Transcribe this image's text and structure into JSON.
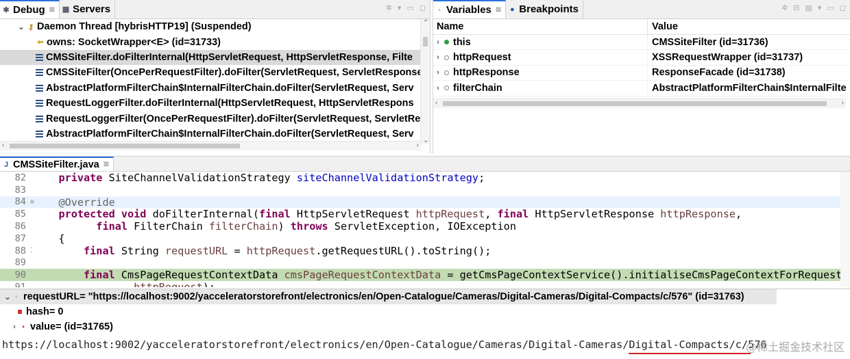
{
  "debug": {
    "tabs": [
      {
        "label": "Debug",
        "close": "⊠"
      },
      {
        "label": "Servers"
      }
    ],
    "thread": "Daemon Thread [hybrisHTTP19] (Suspended)",
    "frames": [
      {
        "label": "owns: SocketWrapper<E>  (id=31733)"
      },
      {
        "label": "CMSSiteFilter.doFilterInternal(HttpServletRequest, HttpServletResponse, Filte"
      },
      {
        "label": "CMSSiteFilter(OncePerRequestFilter).doFilter(ServletRequest, ServletResponse"
      },
      {
        "label": "AbstractPlatformFilterChain$InternalFilterChain.doFilter(ServletRequest, Serv"
      },
      {
        "label": "RequestLoggerFilter.doFilterInternal(HttpServletRequest, HttpServletRespons"
      },
      {
        "label": "RequestLoggerFilter(OncePerRequestFilter).doFilter(ServletRequest, ServletRe"
      },
      {
        "label": "AbstractPlatformFilterChain$InternalFilterChain.doFilter(ServletRequest, Serv"
      }
    ]
  },
  "variables": {
    "tabs": [
      {
        "label": "Variables",
        "close": "⊠"
      },
      {
        "label": "Breakpoints"
      }
    ],
    "columns": {
      "name": "Name",
      "value": "Value"
    },
    "rows": [
      {
        "name": "this",
        "value": "CMSSiteFilter  (id=31736)"
      },
      {
        "name": "httpRequest",
        "value": "XSSRequestWrapper  (id=31737)"
      },
      {
        "name": "httpResponse",
        "value": "ResponseFacade  (id=31738)"
      },
      {
        "name": "filterChain",
        "value": "AbstractPlatformFilterChain$InternalFilte"
      }
    ]
  },
  "editor": {
    "tab_label": "CMSSiteFilter.java",
    "tab_close": "⊠",
    "line_numbers": [
      "82",
      "83",
      "84",
      "85",
      "86",
      "87",
      "88",
      "89",
      "90",
      "91"
    ]
  },
  "detail": {
    "selected_expr": "requestURL= \"https://localhost:9002/yacceleratorstorefront/electronics/en/Open-Catalogue/Cameras/Digital-Cameras/Digital-Compacts/c/576\" (id=31763)",
    "children": [
      {
        "label": "hash= 0"
      },
      {
        "label": "value= (id=31765)"
      }
    ],
    "value_text": "https://localhost:9002/yacceleratorstorefront/electronics/en/Open-Catalogue/Cameras/Digital-Cameras/Digital-Compacts/c/576",
    "watermark": "@稀土掘金技术社区"
  }
}
